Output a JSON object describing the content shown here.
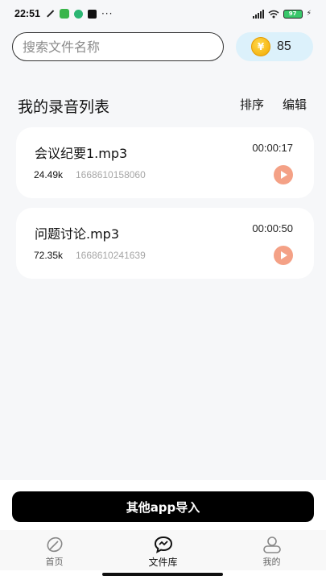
{
  "status_bar": {
    "time": "22:51",
    "dots": "···",
    "battery": "97"
  },
  "search": {
    "placeholder": "搜索文件名称",
    "value": ""
  },
  "coins": {
    "count": "85",
    "icon": "coin-icon"
  },
  "list": {
    "title": "我的录音列表",
    "sort_label": "排序",
    "edit_label": "编辑"
  },
  "recordings": [
    {
      "name": "会议纪要1.mp3",
      "duration": "00:00:17",
      "size": "24.49k",
      "stamp": "1668610158060"
    },
    {
      "name": "问题讨论.mp3",
      "duration": "00:00:50",
      "size": "72.35k",
      "stamp": "1668610241639"
    }
  ],
  "import_button": {
    "label": "其他app导入"
  },
  "tabs": [
    {
      "label": "首页",
      "icon": "leaf-icon",
      "active": false
    },
    {
      "label": "文件库",
      "icon": "chat-icon",
      "active": true
    },
    {
      "label": "我的",
      "icon": "profile-icon",
      "active": false
    }
  ],
  "colors": {
    "accent_play": "#f4a186",
    "coin_pill_bg": "#dcf1fb",
    "background": "#f6f7f9"
  }
}
